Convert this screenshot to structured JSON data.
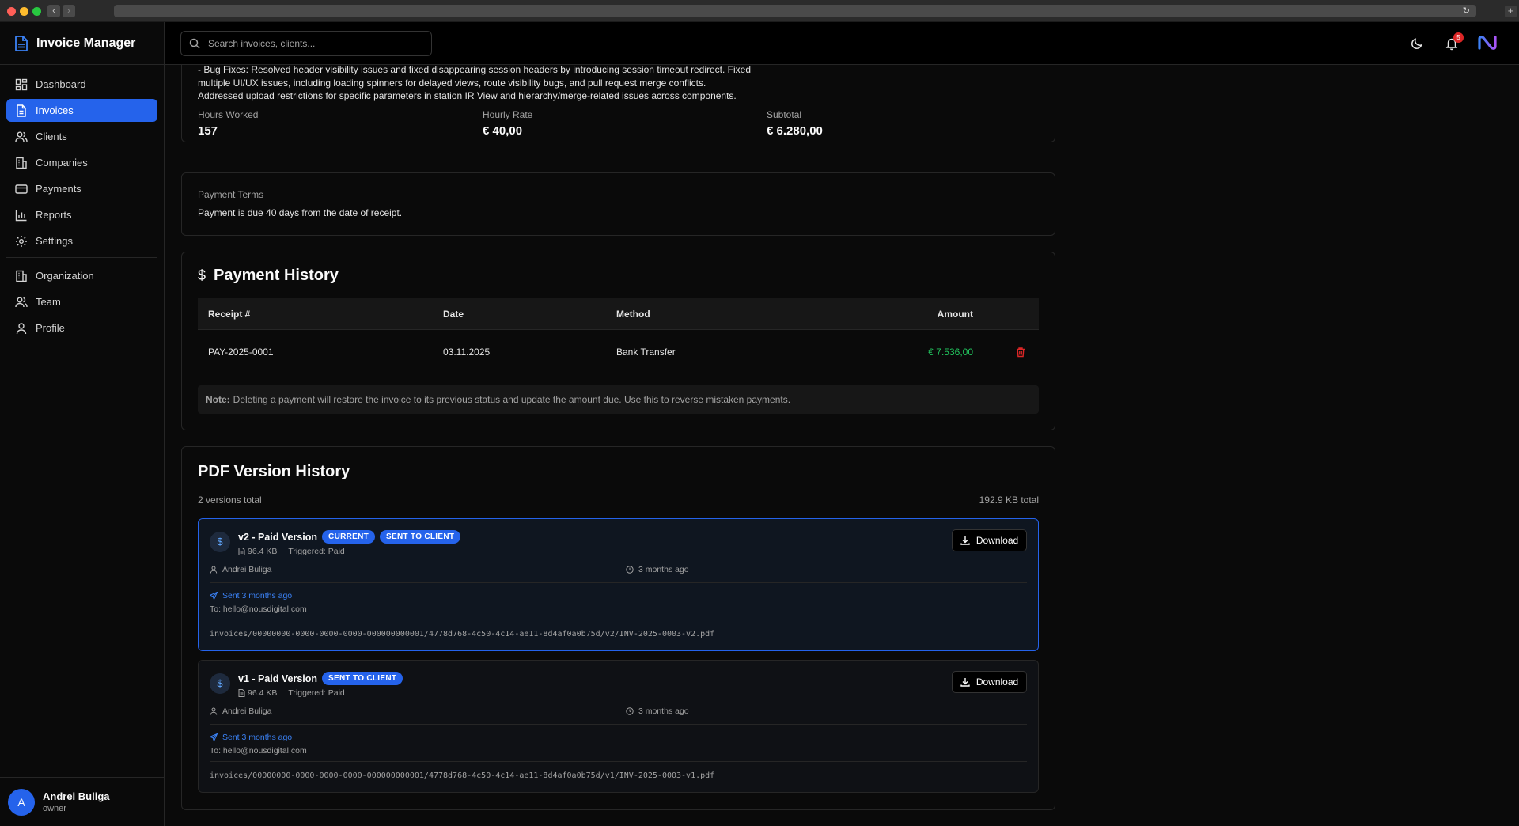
{
  "app": {
    "title": "Invoice Manager"
  },
  "sidebar": {
    "items": [
      {
        "label": "Dashboard",
        "icon": "dashboard-icon"
      },
      {
        "label": "Invoices",
        "icon": "file-icon",
        "active": true
      },
      {
        "label": "Clients",
        "icon": "users-icon"
      },
      {
        "label": "Companies",
        "icon": "building-icon"
      },
      {
        "label": "Payments",
        "icon": "credit-card-icon"
      },
      {
        "label": "Reports",
        "icon": "bar-chart-icon"
      },
      {
        "label": "Settings",
        "icon": "gear-icon"
      }
    ],
    "items2": [
      {
        "label": "Organization",
        "icon": "building-icon"
      },
      {
        "label": "Team",
        "icon": "users-icon"
      },
      {
        "label": "Profile",
        "icon": "user-icon"
      }
    ],
    "user": {
      "initial": "A",
      "name": "Andrei Buliga",
      "role": "owner"
    }
  },
  "topbar": {
    "search_placeholder": "Search invoices, clients...",
    "notification_count": "5"
  },
  "work": {
    "description_lines": [
      "- Bug Fixes: Resolved header visibility issues and fixed disappearing session headers by introducing session timeout redirect. Fixed",
      "multiple UI/UX issues, including loading spinners for delayed views, route visibility bugs, and pull request merge conflicts.",
      "Addressed upload restrictions for specific parameters in station IR View and hierarchy/merge-related issues across components."
    ],
    "hours_label": "Hours Worked",
    "hours_value": "157",
    "rate_label": "Hourly Rate",
    "rate_value": "€ 40,00",
    "subtotal_label": "Subtotal",
    "subtotal_value": "€ 6.280,00"
  },
  "terms": {
    "label": "Payment Terms",
    "text": "Payment is due 40 days from the date of receipt."
  },
  "payment_history": {
    "title": "Payment History",
    "columns": [
      "Receipt #",
      "Date",
      "Method",
      "Amount"
    ],
    "rows": [
      {
        "receipt": "PAY-2025-0001",
        "date": "03.11.2025",
        "method": "Bank Transfer",
        "amount": "€ 7.536,00"
      }
    ],
    "note_label": "Note:",
    "note_text": "Deleting a payment will restore the invoice to its previous status and update the amount due. Use this to reverse mistaken payments."
  },
  "pdf_history": {
    "title": "PDF Version History",
    "count_text": "2 versions total",
    "size_text": "192.9 KB total",
    "download_label": "Download",
    "versions": [
      {
        "name": "v2 - Paid Version",
        "badges": [
          "CURRENT",
          "SENT TO CLIENT"
        ],
        "size": "96.4 KB",
        "triggered": "Triggered: Paid",
        "user": "Andrei Buliga",
        "time": "3 months ago",
        "sent": "Sent 3 months ago",
        "to": "To: hello@nousdigital.com",
        "path": "invoices/00000000-0000-0000-0000-000000000001/4778d768-4c50-4c14-ae11-8d4af0a0b75d/v2/INV-2025-0003-v2.pdf"
      },
      {
        "name": "v1 - Paid Version",
        "badges": [
          "SENT TO CLIENT"
        ],
        "size": "96.4 KB",
        "triggered": "Triggered: Paid",
        "user": "Andrei Buliga",
        "time": "3 months ago",
        "sent": "Sent 3 months ago",
        "to": "To: hello@nousdigital.com",
        "path": "invoices/00000000-0000-0000-0000-000000000001/4778d768-4c50-4c14-ae11-8d4af0a0b75d/v1/INV-2025-0003-v1.pdf"
      }
    ]
  },
  "colors": {
    "accent": "#2563eb",
    "amount": "#22c55e",
    "danger": "#dc2626",
    "link": "#3b82f6"
  }
}
